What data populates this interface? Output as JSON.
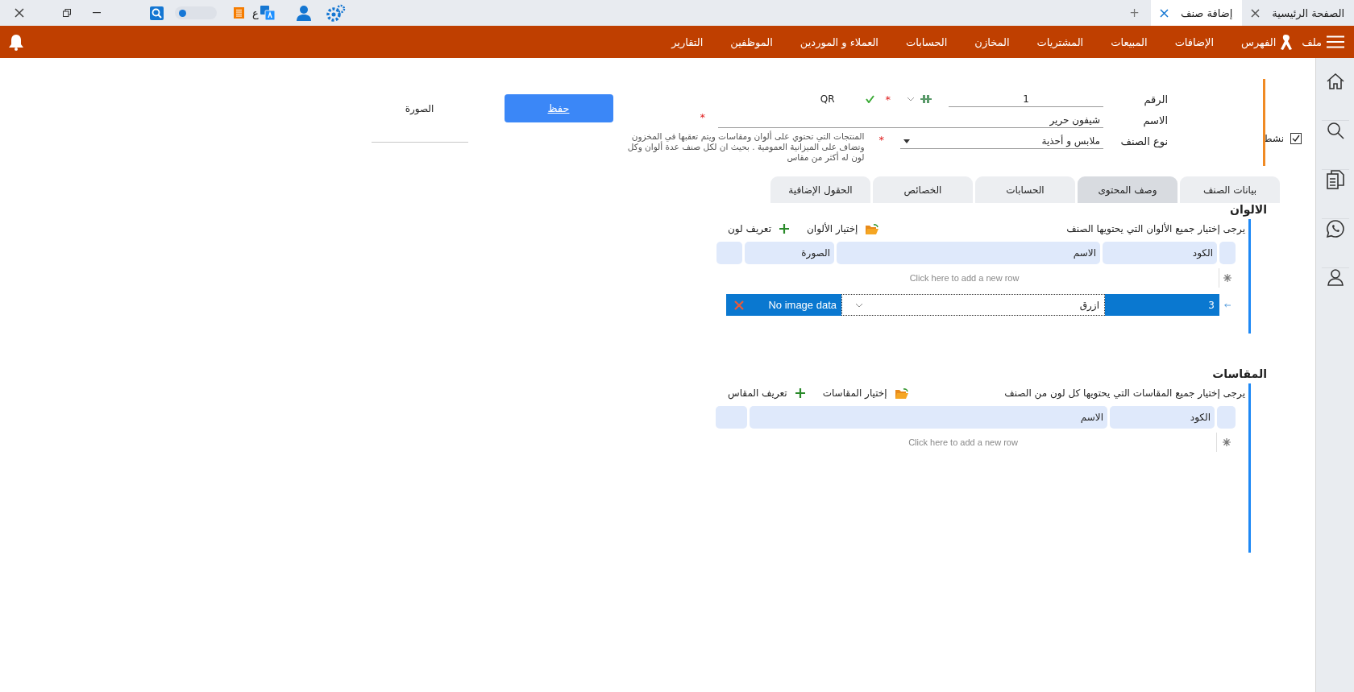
{
  "window_controls": {
    "toggle": {
      "on": false
    },
    "language": "ع"
  },
  "window_tabs": [
    {
      "label": "الصفحة الرئيسية",
      "selected": false
    },
    {
      "label": "إضافة صنف",
      "selected": true
    }
  ],
  "new_tab": "+",
  "menu": [
    {
      "label": "ملف",
      "kind": "text"
    },
    {
      "label": "الفهرس",
      "kind": "ribbon"
    },
    {
      "label": "الإضافات",
      "kind": "text"
    },
    {
      "label": "المبيعات",
      "kind": "text"
    },
    {
      "label": "المشتريات",
      "kind": "text"
    },
    {
      "label": "المخازن",
      "kind": "text"
    },
    {
      "label": "الحسابات",
      "kind": "text"
    },
    {
      "label": "العملاء و الموردين",
      "kind": "text"
    },
    {
      "label": "الموظفين",
      "kind": "text"
    },
    {
      "label": "التقارير",
      "kind": "text"
    }
  ],
  "form": {
    "number_label": "الرقم",
    "number": "1",
    "number_mark": "*",
    "qr": "QR",
    "name_label": "الاسم",
    "name": "شيفون حرير",
    "name_mark": "*",
    "type_label": "نوع الصنف",
    "type": "ملابس و أحذية",
    "type_mark": "*",
    "type_description": "المنتجات التي تحتوي على ألوان ومقاسات ويتم تعقبها في المخزون وتضاف على الميزانية العمومية . بحيث ان لكل صنف عدة ألوان وكل لون له أكثر من مقاس",
    "active": {
      "label": "نشط",
      "checked": true
    }
  },
  "save_button": "حفظ",
  "image_label": "الصورة",
  "tabs": [
    {
      "label": "بيانات الصنف",
      "selected": false
    },
    {
      "label": "وصف المحتوى",
      "selected": true
    },
    {
      "label": "الحسابات",
      "selected": false
    },
    {
      "label": "الخصائص",
      "selected": false
    },
    {
      "label": "الحقول الإضافية",
      "selected": false
    }
  ],
  "colors": {
    "title": "الالوان",
    "hint": "يرجى إختيار جميع الألوان التي يحتويها الصنف",
    "actions": [
      {
        "kind": "pick",
        "label": "إختيار الألوان"
      },
      {
        "kind": "define",
        "label": "تعريف لون"
      }
    ],
    "columns": [
      "الكود",
      "الاسم",
      "الصورة"
    ],
    "new_row": "Click here to add a new row",
    "rows": [
      {
        "code": "3",
        "name": "ازرق",
        "image": "No image data",
        "selected": true
      }
    ]
  },
  "sizes": {
    "title": "المقاسات",
    "hint": "يرجى إختيار جميع المقاسات التي يحتويها كل لون من الصنف",
    "actions": [
      {
        "kind": "pick",
        "label": "إختيار المقاسات"
      },
      {
        "kind": "define",
        "label": "تعريف المقاس"
      }
    ],
    "columns": [
      "الكود",
      "الاسم"
    ],
    "new_row": "Click here to add a new row"
  }
}
